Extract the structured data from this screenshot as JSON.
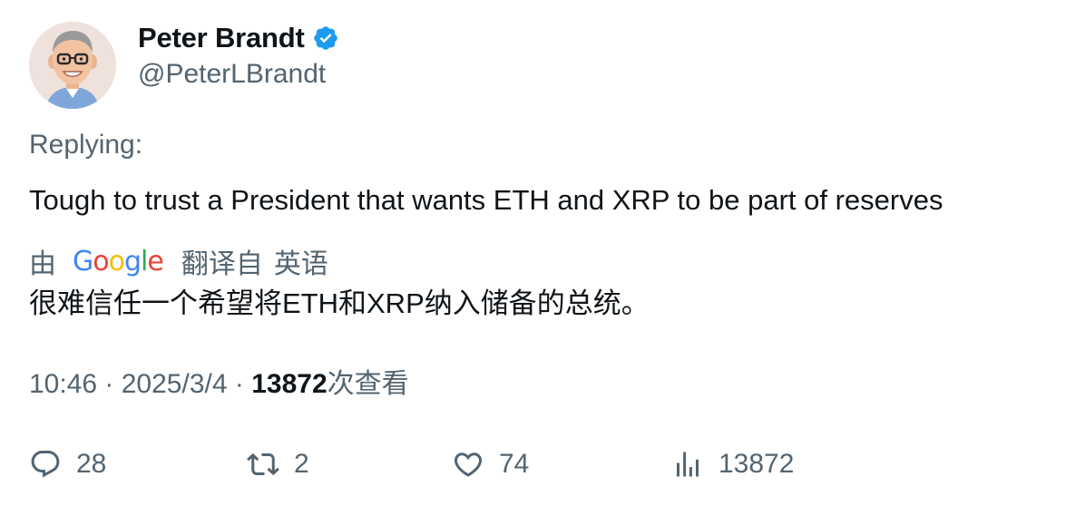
{
  "author": {
    "display_name": "Peter Brandt",
    "handle": "@PeterLBrandt",
    "verified": true,
    "verified_color": "#1d9bf0"
  },
  "replying_label": "Replying:",
  "tweet_text": "Tough to trust a President that wants ETH and XRP to be part of reserves",
  "translation": {
    "by_label": "由",
    "provider_letters": [
      "G",
      "o",
      "o",
      "g",
      "l",
      "e"
    ],
    "translated_from_label": "翻译自",
    "language": "英语",
    "text": "很难信任一个希望将ETH和XRP纳入储备的总统。"
  },
  "meta": {
    "time": "10:46",
    "separator": " · ",
    "date": "2025/3/4",
    "views_count": "13872",
    "views_label": "次查看"
  },
  "actions": {
    "replies": "28",
    "retweets": "2",
    "likes": "74",
    "views": "13872"
  },
  "icons": {
    "reply": "reply-bubble-icon",
    "retweet": "retweet-icon",
    "like": "heart-icon",
    "views": "bar-chart-icon",
    "verified": "verified-badge-icon"
  },
  "colors": {
    "text_primary": "#0f1419",
    "text_secondary": "#536471",
    "google_blue": "#4285f4",
    "google_red": "#ea4335",
    "google_yellow": "#fbbc05",
    "google_green": "#34a853"
  }
}
